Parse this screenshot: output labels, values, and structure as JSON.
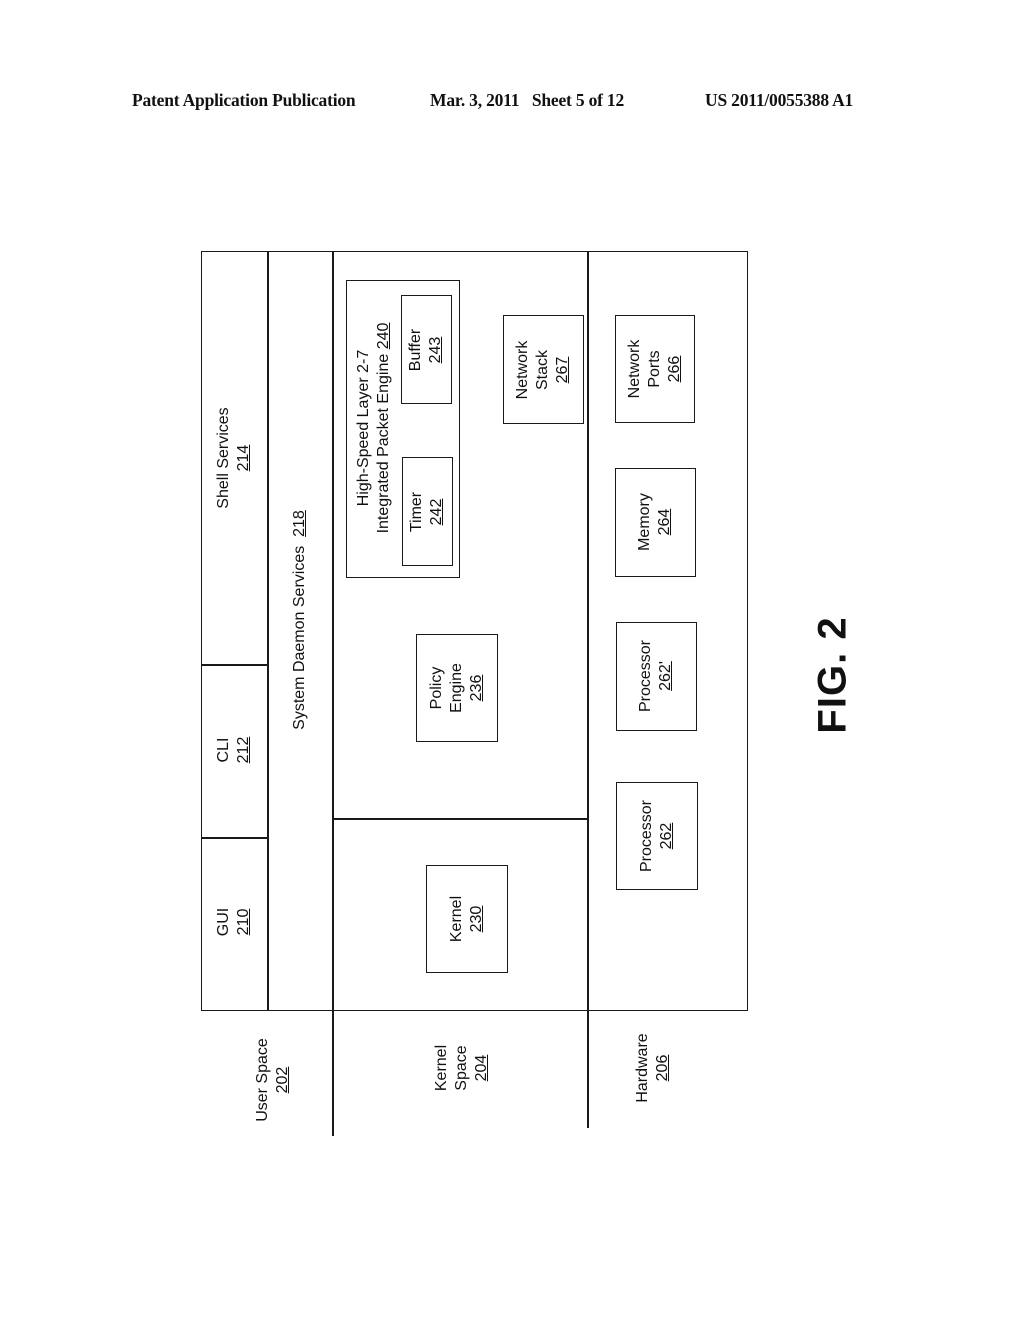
{
  "header": {
    "publication": "Patent Application Publication",
    "date_sheet": "Mar. 3, 2011   Sheet 5 of 12",
    "patent_number": "US 2011/0055388 A1"
  },
  "figure_label": "FIG. 2",
  "layers": {
    "user_space": {
      "label": "User Space",
      "ref": "202"
    },
    "kernel_space": {
      "label_line1": "Kernel",
      "label_line2": "Space",
      "ref": "204"
    },
    "hardware": {
      "label": "Hardware",
      "ref": "206"
    }
  },
  "user_space_blocks": {
    "gui": {
      "label": "GUI",
      "ref": "210"
    },
    "cli": {
      "label": "CLI",
      "ref": "212"
    },
    "shell_services": {
      "label": "Shell Services",
      "ref": "214"
    },
    "system_daemon_services": {
      "label": "System Daemon Services",
      "ref": "218"
    }
  },
  "kernel_blocks": {
    "kernel": {
      "label": "Kernel",
      "ref": "230"
    },
    "policy_engine": {
      "label_line1": "Policy",
      "label_line2": "Engine",
      "ref": "236"
    },
    "packet_engine": {
      "label_line1": "High-Speed Layer 2-7",
      "label_line2": "Integrated Packet Engine",
      "ref": "240"
    },
    "timer": {
      "label": "Timer",
      "ref": "242"
    },
    "buffer": {
      "label": "Buffer",
      "ref": "243"
    },
    "network_stack": {
      "label_line1": "Network",
      "label_line2": "Stack",
      "ref": "267"
    }
  },
  "hardware_blocks": {
    "processor_1": {
      "label": "Processor",
      "ref": "262"
    },
    "processor_2": {
      "label": "Processor",
      "ref": "262'"
    },
    "memory": {
      "label": "Memory",
      "ref": "264"
    },
    "network_ports": {
      "label_line1": "Network",
      "label_line2": "Ports",
      "ref": "266"
    }
  }
}
